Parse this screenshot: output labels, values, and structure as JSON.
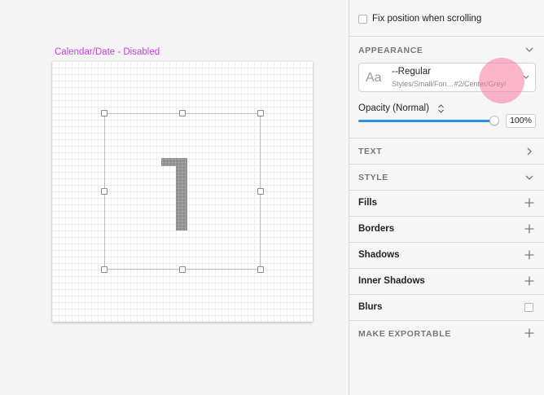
{
  "colors": {
    "artboard_label": "#c23fd6",
    "slider_accent": "#2e8ee6",
    "glyph": "#8f8f8f",
    "touch_indicator": "#fa78a0"
  },
  "canvas": {
    "artboard_label": "Calendar/Date - Disabled",
    "glyph_icon": "pixel-digit-one-icon"
  },
  "inspector": {
    "fix_position_label": "Fix position when scrolling",
    "fix_position_checked": false,
    "appearance": {
      "title": "APPEARANCE",
      "style_preview": "Aa",
      "style_name": "--Regular",
      "style_path": "Styles/Small/Fon…#2/Center/Grey/"
    },
    "opacity": {
      "label": "Opacity (Normal)",
      "value_text": "100%",
      "value": 1.0
    },
    "sections": {
      "text": "TEXT",
      "style": "STYLE",
      "fills": "Fills",
      "borders": "Borders",
      "shadows": "Shadows",
      "inner_shadows": "Inner Shadows",
      "blurs": "Blurs",
      "make_exportable": "MAKE EXPORTABLE"
    },
    "blurs_checked": false
  }
}
